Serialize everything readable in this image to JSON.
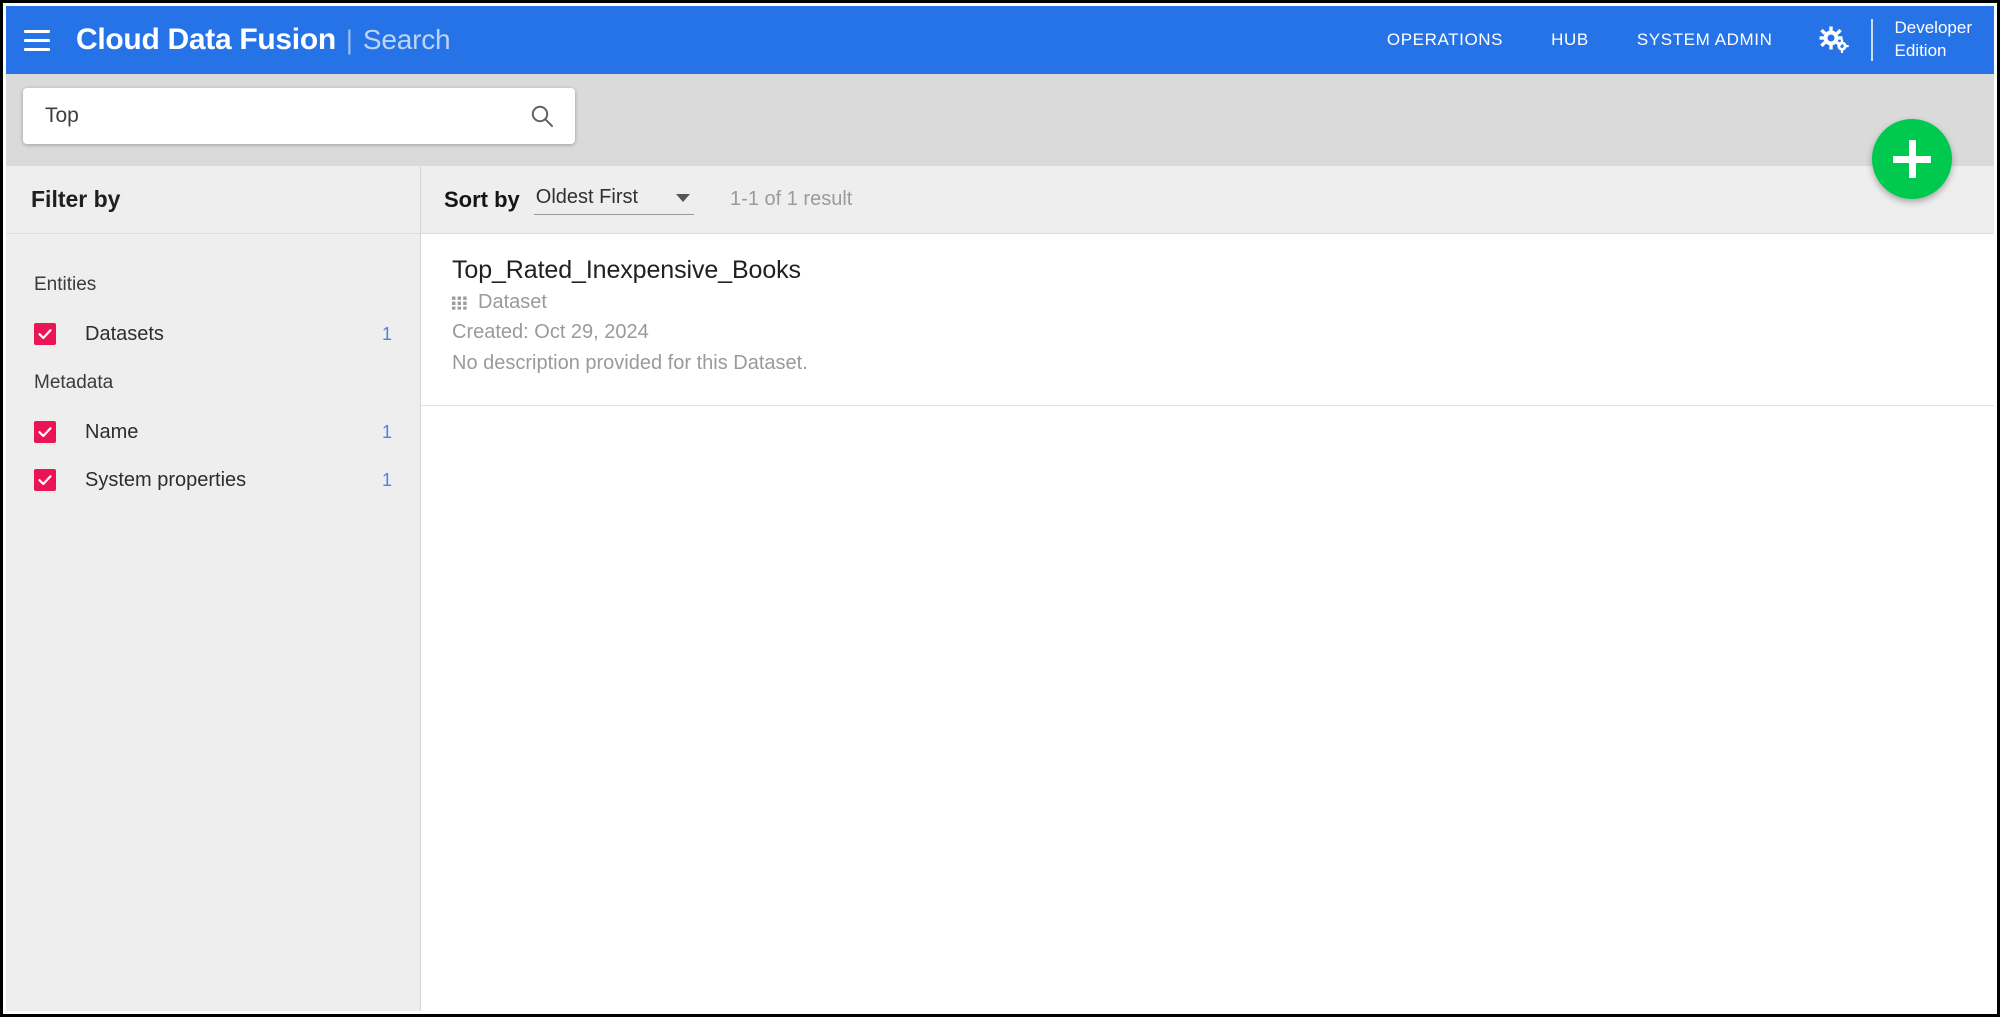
{
  "header": {
    "menu_icon": "hamburger-menu-icon",
    "brand_title": "Cloud Data Fusion",
    "brand_separator": "|",
    "brand_section": "Search",
    "nav": [
      {
        "label": "OPERATIONS"
      },
      {
        "label": "HUB"
      },
      {
        "label": "SYSTEM ADMIN"
      }
    ],
    "settings_icon": "cogs-icon",
    "edition_line1": "Developer",
    "edition_line2": "Edition"
  },
  "search": {
    "value": "Top",
    "placeholder": "Search",
    "icon": "search-icon"
  },
  "fab": {
    "icon": "plus-icon",
    "color": "#00c950"
  },
  "sidebar": {
    "title": "Filter by",
    "groups": [
      {
        "title": "Entities",
        "items": [
          {
            "label": "Datasets",
            "count": "1",
            "checked": true
          }
        ]
      },
      {
        "title": "Metadata",
        "items": [
          {
            "label": "Name",
            "count": "1",
            "checked": true
          },
          {
            "label": "System properties",
            "count": "1",
            "checked": true
          }
        ]
      }
    ],
    "checkbox_color": "#eb1556",
    "count_color": "#4d7fe8"
  },
  "sortbar": {
    "label": "Sort by",
    "selected": "Oldest First",
    "caret_icon": "chevron-down-icon",
    "result_count": "1-1 of 1 result"
  },
  "results": [
    {
      "title": "Top_Rated_Inexpensive_Books",
      "type_icon": "grid-dots-icon",
      "type": "Dataset",
      "created": "Created: Oct 29, 2024",
      "description": "No description provided for this Dataset."
    }
  ]
}
